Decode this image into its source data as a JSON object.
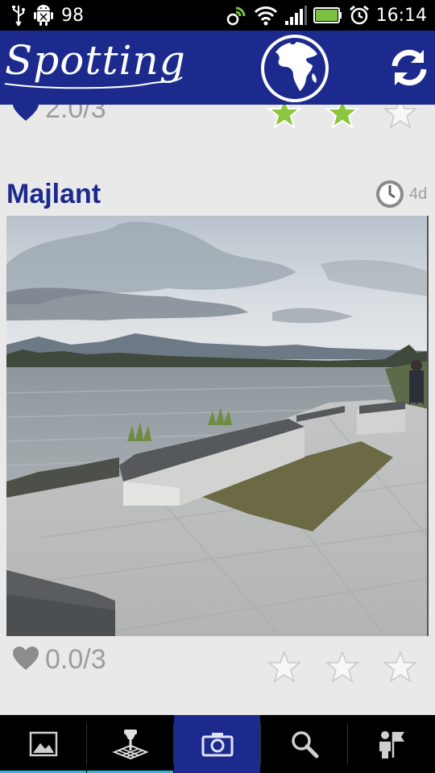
{
  "status_bar": {
    "battery_level": "98",
    "time": "16:14",
    "icons": [
      "usb-icon",
      "android-debug-icon",
      "data-sync-icon",
      "wifi-icon",
      "signal-icon",
      "battery-icon",
      "alarm-icon"
    ]
  },
  "app_bar": {
    "logo_text": "Spotting",
    "icons": [
      "globe-icon",
      "refresh-icon"
    ],
    "colors": {
      "bar": "#1b2a8c",
      "title": "#1b2a8c",
      "star_active": "#8cc63f"
    }
  },
  "feed": {
    "previous_post": {
      "score": "2.0/3",
      "stars_filled": 2,
      "stars_total": 3,
      "icon": "heart-icon"
    },
    "post": {
      "title": "Majlant",
      "age": "4d",
      "icon": "clock-icon",
      "photo": "waterfront-promenade-with-benches",
      "score": "0.0/3",
      "stars_filled": 0,
      "stars_total": 3
    }
  },
  "bottom_nav": {
    "tabs": [
      {
        "name": "tab-gallery",
        "icon": "image-icon",
        "selected": true
      },
      {
        "name": "tab-map",
        "icon": "map-pin-icon",
        "selected": false
      },
      {
        "name": "tab-camera",
        "icon": "camera-icon",
        "active": true
      },
      {
        "name": "tab-search",
        "icon": "search-icon",
        "selected": false
      },
      {
        "name": "tab-profile",
        "icon": "user-flag-icon",
        "selected": false
      }
    ]
  }
}
